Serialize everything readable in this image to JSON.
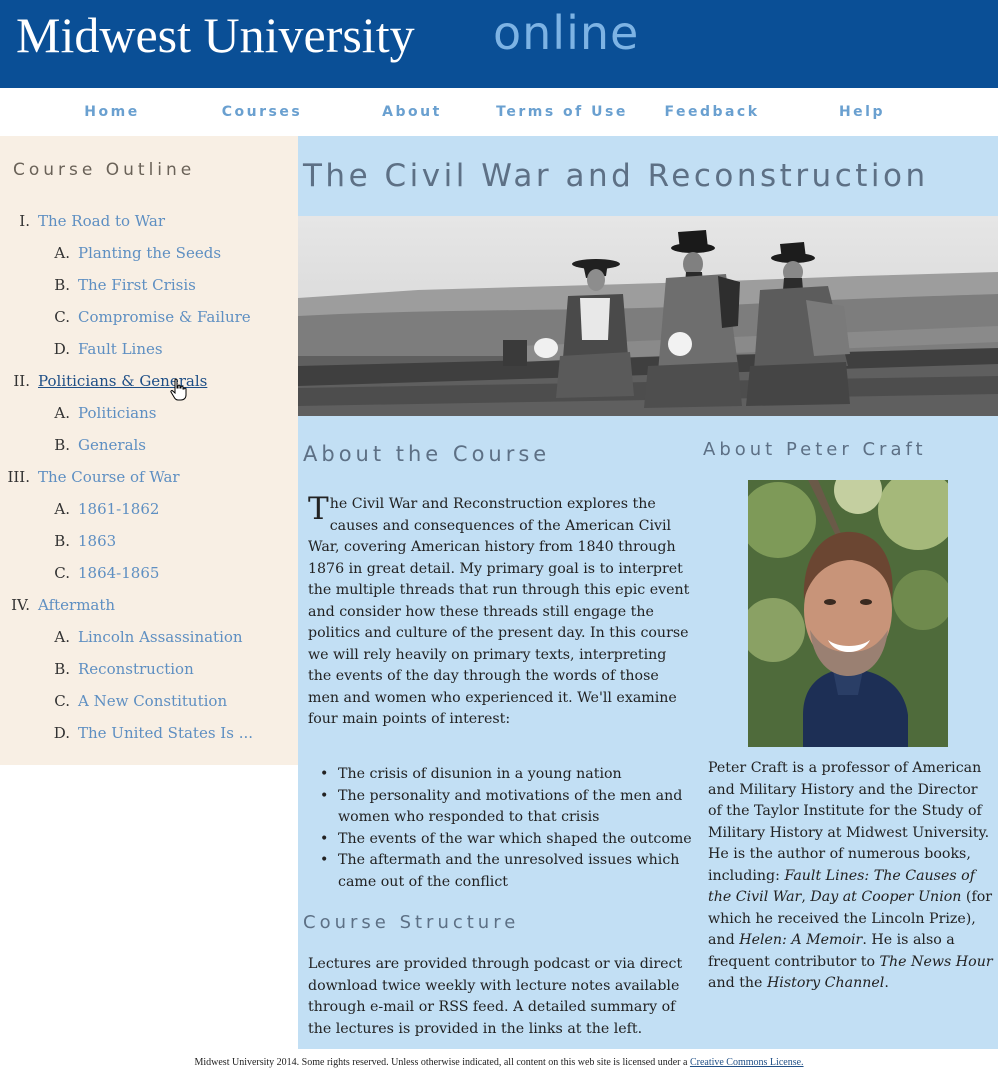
{
  "header": {
    "site_name": "Midwest University",
    "site_sub": "online"
  },
  "nav": {
    "items": [
      "Home",
      "Courses",
      "About",
      "Terms of Use",
      "Feedback",
      "Help"
    ]
  },
  "sidebar": {
    "title": "Course Outline",
    "outline": [
      {
        "num": "I.",
        "label": "The Road to War",
        "items": [
          {
            "num": "A.",
            "label": "Planting the Seeds"
          },
          {
            "num": "B.",
            "label": "The First Crisis"
          },
          {
            "num": "C.",
            "label": "Compromise & Failure"
          },
          {
            "num": "D.",
            "label": "Fault Lines"
          }
        ]
      },
      {
        "num": "II.",
        "label": "Politicians & Generals",
        "items": [
          {
            "num": "A.",
            "label": "Politicians"
          },
          {
            "num": "B.",
            "label": "Generals"
          }
        ]
      },
      {
        "num": "III.",
        "label": "The Course of War",
        "items": [
          {
            "num": "A.",
            "label": "1861-1862"
          },
          {
            "num": "B.",
            "label": "1863"
          },
          {
            "num": "C.",
            "label": "1864-1865"
          }
        ]
      },
      {
        "num": "IV.",
        "label": "Aftermath",
        "items": [
          {
            "num": "A.",
            "label": "Lincoln Assassination"
          },
          {
            "num": "B.",
            "label": "Reconstruction"
          },
          {
            "num": "C.",
            "label": "A New Constitution"
          },
          {
            "num": "D.",
            "label": "The United States Is ..."
          }
        ]
      }
    ]
  },
  "main": {
    "title": "The Civil War and Reconstruction",
    "about_heading": "About the Course",
    "about_dropcap": "T",
    "about_text": "he Civil War and Reconstruction explores the causes and consequences of the American Civil War, covering American history from 1840 through 1876 in great detail. My primary goal is to interpret the multiple threads that run through this epic event and consider how these threads still engage the politics and culture of the present day. In this course we will rely heavily on primary texts, interpreting the events of the day through the words of those men and women who experienced it. We'll examine four main points of interest:",
    "bullets": [
      "The crisis of disunion in a young nation",
      "The personality and motivations of the men and women who responded to that crisis",
      "The events of the war which shaped the outcome",
      "The aftermath and the unresolved issues which came out of the conflict"
    ],
    "structure_heading": "Course Structure",
    "structure_text": "Lectures are provided through podcast or via direct download twice weekly with lecture notes available through e-mail or RSS feed. A detailed summary of the lectures is provided in the links at the left.",
    "author_heading": "About Peter Craft",
    "bio": {
      "p1": "Peter Craft is a professor of American and Military History and the Director of the Taylor Institute for the Study of Military History at Midwest University. He is the author of numerous books, including: ",
      "book1": "Fault Lines: The Causes of the Civil War",
      "sep1": ", ",
      "book2": "Day at Cooper Union",
      "p2": " (for which he received the Lincoln Prize), and ",
      "book3": "Helen: A Memoir",
      "p3": ". He is also a frequent contributor to ",
      "show1": "The News Hour",
      "p4": " and the ",
      "show2": "History Channel",
      "p5": "."
    }
  },
  "footer": {
    "text": "Midwest University 2014. Some rights reserved. Unless otherwise indicated, all content on this web site is licensed under a ",
    "link": "Creative Commons License."
  },
  "colors": {
    "header_bg": "#0a4f96",
    "nav_text": "#6aa0d0",
    "sidebar_bg": "#f8efe4",
    "main_bg": "#c2dff4",
    "link": "#5e8fc2",
    "heading": "#5d7085"
  }
}
